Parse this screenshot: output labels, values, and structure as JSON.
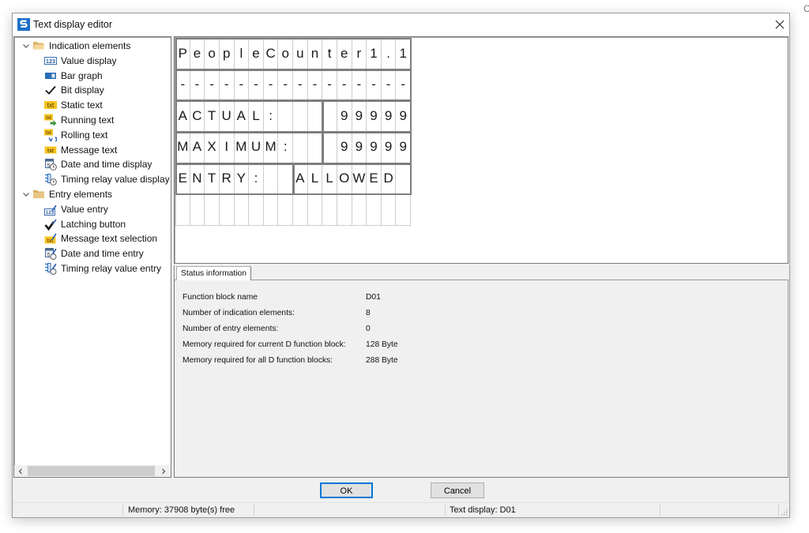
{
  "window": {
    "title": "Text display editor"
  },
  "background": {
    "fragment_text": "C"
  },
  "tree": {
    "groups": [
      {
        "label": "Indication elements",
        "expanded": true,
        "icon": "folder-open-icon",
        "items": [
          {
            "label": "Value display",
            "icon": "value-display-icon"
          },
          {
            "label": "Bar graph",
            "icon": "bar-graph-icon"
          },
          {
            "label": "Bit display",
            "icon": "check-icon"
          },
          {
            "label": "Static text",
            "icon": "static-text-icon"
          },
          {
            "label": "Running text",
            "icon": "running-text-icon"
          },
          {
            "label": "Rolling text",
            "icon": "rolling-text-icon"
          },
          {
            "label": "Message text",
            "icon": "message-text-icon"
          },
          {
            "label": "Date and time display",
            "icon": "date-time-icon"
          },
          {
            "label": "Timing relay value display",
            "icon": "timing-relay-icon"
          }
        ]
      },
      {
        "label": "Entry elements",
        "expanded": true,
        "icon": "folder-icon",
        "items": [
          {
            "label": "Value entry",
            "icon": "value-entry-icon"
          },
          {
            "label": "Latching button",
            "icon": "latching-button-icon"
          },
          {
            "label": "Message text selection",
            "icon": "message-text-selection-icon"
          },
          {
            "label": "Date and time entry",
            "icon": "date-time-entry-icon"
          },
          {
            "label": "Timing relay value entry",
            "icon": "timing-relay-entry-icon"
          }
        ]
      }
    ]
  },
  "display": {
    "columns": 16,
    "rows": [
      {
        "elements": [
          "PeopleCounter1.1"
        ]
      },
      {
        "elements": [
          "----------------"
        ]
      },
      {
        "elements": [
          "ACTUAL:   ",
          " 99999"
        ]
      },
      {
        "elements": [
          "MAXIMUM:  ",
          " 99999"
        ]
      },
      {
        "elements": [
          "ENTRY:  ",
          "ALLOWED "
        ]
      },
      {
        "elements": []
      }
    ]
  },
  "status_info": {
    "tab_label": "Status information",
    "rows": [
      {
        "label": "Function block name",
        "value": "D01"
      },
      {
        "label": "Number of indication elements:",
        "value": "8"
      },
      {
        "label": "Number of entry elements:",
        "value": "0"
      },
      {
        "label": "Memory required for current D function block:",
        "value": "128 Byte"
      },
      {
        "label": "Memory required for all D function blocks:",
        "value": "288 Byte"
      }
    ]
  },
  "buttons": {
    "ok": "OK",
    "cancel": "Cancel"
  },
  "statusbar": {
    "memory": "Memory: 37908 byte(s) free",
    "text_display": "Text display: D01"
  },
  "colors": {
    "accent": "#0078d7",
    "app_icon": "#1e6fc8",
    "lcd_group_border": "#7e7e7e",
    "text_badge": "#f7c21f"
  }
}
